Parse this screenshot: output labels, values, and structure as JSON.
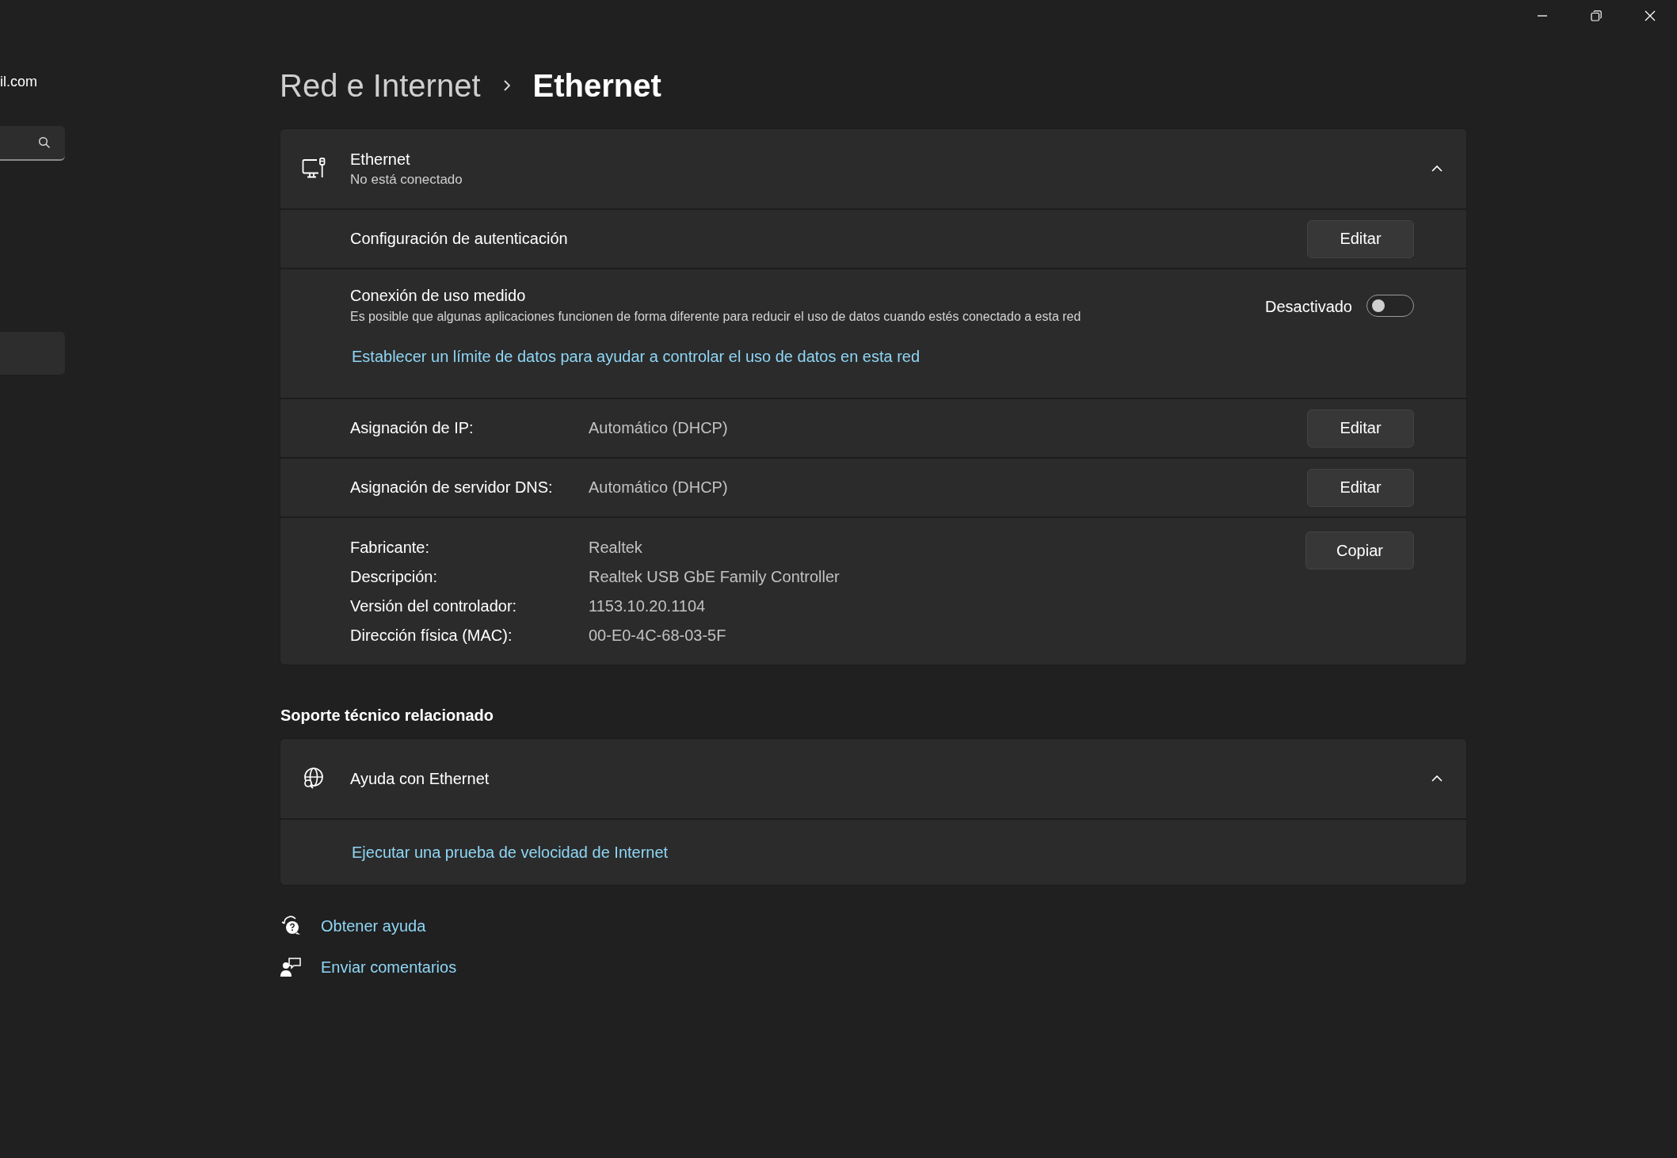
{
  "sidebar": {
    "account_email": "il.com"
  },
  "breadcrumb": [
    {
      "label": "Red e Internet",
      "selected": false
    },
    {
      "label": "Ethernet",
      "selected": true
    }
  ],
  "adapter": {
    "title": "Ethernet",
    "status": "No está conectado",
    "expanded": true,
    "rows": [
      {
        "kind": "setting",
        "label": "Configuración de autenticación",
        "button": "Editar"
      },
      {
        "kind": "toggle",
        "label": "Conexión de uso medido",
        "description": "Es posible que algunas aplicaciones funcionen de forma diferente para reducir el uso de datos cuando estés conectado a esta red",
        "state_label": "Desactivado",
        "on": false,
        "link": "Establecer un límite de datos para ayudar a controlar el uso de datos en esta red"
      },
      {
        "kind": "property",
        "label": "Asignación de IP:",
        "value": "Automático (DHCP)",
        "button": "Editar"
      },
      {
        "kind": "property",
        "label": "Asignación de servidor DNS:",
        "value": "Automático (DHCP)",
        "button": "Editar"
      },
      {
        "kind": "details",
        "button": "Copiar",
        "properties": [
          {
            "label": "Fabricante:",
            "value": "Realtek"
          },
          {
            "label": "Descripción:",
            "value": "Realtek USB GbE Family Controller"
          },
          {
            "label": "Versión del controlador:",
            "value": "1153.10.20.1104"
          },
          {
            "label": "Dirección física (MAC):",
            "value": "00-E0-4C-68-03-5F"
          }
        ]
      }
    ]
  },
  "related_support": {
    "heading": "Soporte técnico relacionado",
    "cards": [
      {
        "title": "Ayuda con Ethernet",
        "expanded": true,
        "links": [
          "Ejecutar una prueba de velocidad de Internet"
        ]
      }
    ]
  },
  "footer_links": [
    {
      "kind": "help",
      "label": "Obtener ayuda"
    },
    {
      "kind": "feedback",
      "label": "Enviar comentarios"
    }
  ]
}
